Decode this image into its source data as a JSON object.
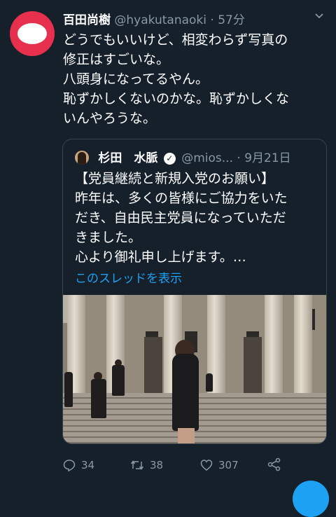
{
  "tweet": {
    "author_name": "百田尚樹",
    "author_handle": "@hyakutanaoki",
    "separator": "·",
    "time": "57分",
    "body_lines": [
      "どうでもいいけど、相変わらず写真の",
      "修正はすごいな。",
      "八頭身になってるやん。",
      "恥ずかしくないのかな。恥ずかしくな",
      "いんやろうな。"
    ]
  },
  "quoted": {
    "author_name": "杉田　水脈",
    "verified_icon": "verified-badge-icon",
    "author_handle": "@mios...",
    "separator": "·",
    "date": "9月21日",
    "body_lines": [
      "【党員継続と新規入党のお願い】",
      "昨年は、多くの皆様にご協力をいた",
      "だき、自由民主党員になっていただ",
      "きました。",
      "心より御礼申し上げます。…"
    ],
    "thread_link": "このスレッドを表示"
  },
  "actions": {
    "reply_count": "34",
    "retweet_count": "38",
    "like_count": "307"
  },
  "colors": {
    "background": "#15202b",
    "muted": "#8899a6",
    "accent": "#1da1f2",
    "border": "#38444d"
  }
}
